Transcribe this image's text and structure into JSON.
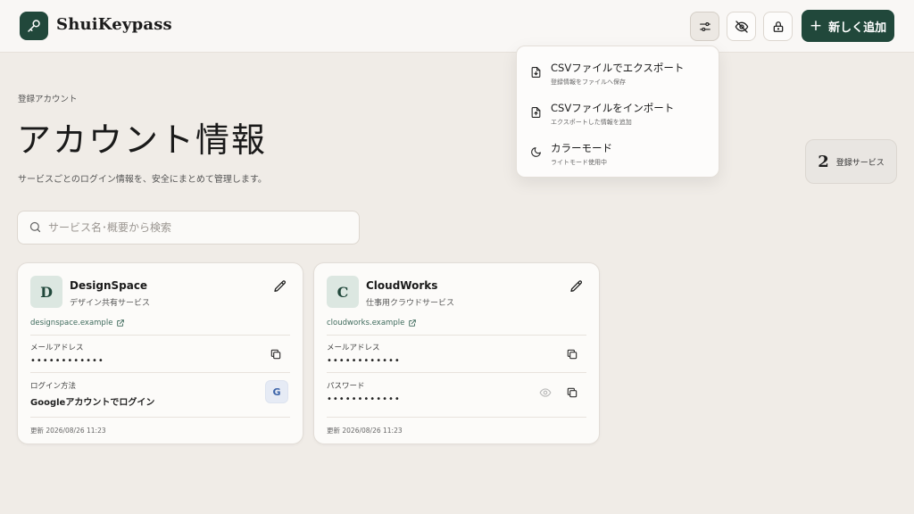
{
  "app": {
    "name": "ShuiKeypass"
  },
  "header": {
    "add_label": "新しく追加"
  },
  "menu": {
    "items": [
      {
        "title": "CSVファイルでエクスポート",
        "subtitle": "登録情報をファイルへ保存"
      },
      {
        "title": "CSVファイルをインポート",
        "subtitle": "エクスポートした情報を追加"
      },
      {
        "title": "カラーモード",
        "subtitle": "ライトモード使用中"
      }
    ]
  },
  "page": {
    "eyebrow": "登録アカウント",
    "title": "アカウント情報",
    "subtitle": "サービスごとのログイン情報を、安全にまとめて管理します。"
  },
  "stats": {
    "count": "2",
    "label": "登録サービス"
  },
  "search": {
    "placeholder": "サービス名･概要から検索",
    "value": ""
  },
  "cards": [
    {
      "initial": "D",
      "name": "DesignSpace",
      "description": "デザイン共有サービス",
      "link": "designspace.example",
      "email_label": "メールアドレス",
      "email_value": "••••••••••••",
      "login_label": "ログイン方法",
      "login_value": "Googleアカウントでログイン",
      "login_badge": "G",
      "updated": "更新 2026/08/26 11:23"
    },
    {
      "initial": "C",
      "name": "CloudWorks",
      "description": "仕事用クラウドサービス",
      "link": "cloudworks.example",
      "email_label": "メールアドレス",
      "email_value": "••••••••••••",
      "password_label": "パスワード",
      "password_value": "••••••••••••",
      "updated": "更新 2026/08/26 11:23"
    }
  ],
  "colors": {
    "accent": "#21483b",
    "background": "#f0ece7",
    "header": "#f9f7f5",
    "card": "#fcfbf9",
    "google": "#3b63a8"
  },
  "icons": {
    "logo": "key-icon",
    "settings": "sliders-icon",
    "visibility": "eye-off-icon",
    "lock": "lock-icon",
    "export": "file-download-icon",
    "import": "file-upload-icon",
    "color_mode": "moon-icon",
    "search": "search-icon",
    "edit": "pencil-icon",
    "external": "external-link-icon",
    "copy": "copy-icon",
    "reveal": "eye-icon"
  }
}
